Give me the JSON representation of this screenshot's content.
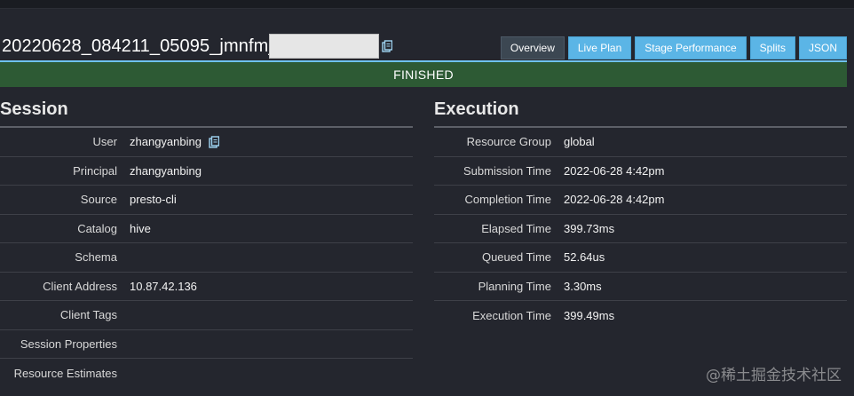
{
  "query": {
    "id": "20220628_084211_05095_jmnfm_",
    "copy_icon": "clipboard-icon"
  },
  "tabs": [
    {
      "label": "Overview",
      "active": true
    },
    {
      "label": "Live Plan",
      "active": false
    },
    {
      "label": "Stage Performance",
      "active": false
    },
    {
      "label": "Splits",
      "active": false
    },
    {
      "label": "JSON",
      "active": false
    }
  ],
  "status": {
    "label": "FINISHED",
    "color": "#2d5a34"
  },
  "session": {
    "title": "Session",
    "rows": [
      {
        "key": "User",
        "value": "zhangyanbing"
      },
      {
        "key": "Principal",
        "value": "zhangyanbing"
      },
      {
        "key": "Source",
        "value": "presto-cli"
      },
      {
        "key": "Catalog",
        "value": "hive"
      },
      {
        "key": "Schema",
        "value": ""
      },
      {
        "key": "Client Address",
        "value": "10.87.42.136"
      },
      {
        "key": "Client Tags",
        "value": ""
      },
      {
        "key": "Session Properties",
        "value": ""
      },
      {
        "key": "Resource Estimates",
        "value": ""
      }
    ]
  },
  "execution": {
    "title": "Execution",
    "rows": [
      {
        "key": "Resource Group",
        "value": "global"
      },
      {
        "key": "Submission Time",
        "value": "2022-06-28 4:42pm"
      },
      {
        "key": "Completion Time",
        "value": "2022-06-28 4:42pm"
      },
      {
        "key": "Elapsed Time",
        "value": "399.73ms"
      },
      {
        "key": "Queued Time",
        "value": "52.64us"
      },
      {
        "key": "Planning Time",
        "value": "3.30ms"
      },
      {
        "key": "Execution Time",
        "value": "399.49ms"
      }
    ]
  },
  "watermark": "@稀土掘金技术社区",
  "colors": {
    "background": "#24262e",
    "tab": "#5bb5e6",
    "tab_active": "#3c4752",
    "accent_line": "#6ec2ee"
  }
}
